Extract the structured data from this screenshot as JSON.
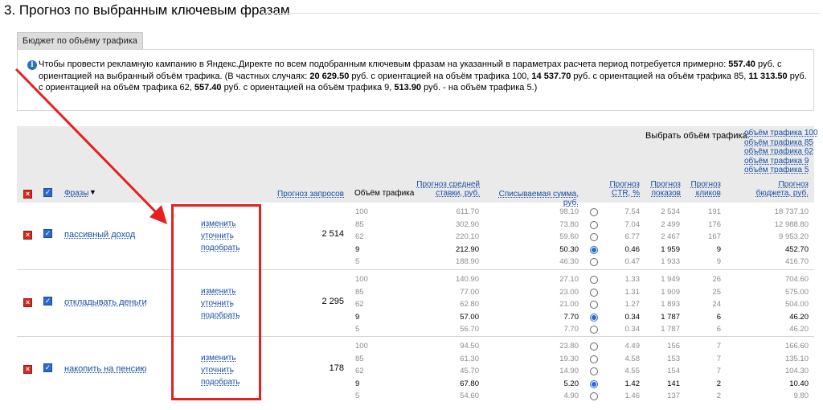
{
  "section": {
    "title": "3. Прогноз по выбранным ключевым фразам"
  },
  "tab": {
    "label": "Бюджет по объёму трафика"
  },
  "info": {
    "t1": "Чтобы провести рекламную кампанию в Яндекс.Директе по всем подобранным ключевым фразам на указанный в параметрах расчета период потребуется примерно: ",
    "b1": "557.40",
    "t2": " руб. с ориентацией на выбранный объём трафика. (В частных случаях: ",
    "b2": "20 629.50",
    "t3": " руб. с ориентацией на объём трафика 100, ",
    "b3": "14 537.70",
    "t4": " руб. с ориентацией на объём трафика 85, ",
    "b4": "11 313.50",
    "t5": " руб. с ориентацией на объём трафика 62, ",
    "b5": "557.40",
    "t6": " руб. с ориентацией на объём трафика 9, ",
    "b6": "513.90",
    "t7": " руб. - на объём трафика 5.)"
  },
  "header": {
    "choose_label": "Выбрать объём трафика:",
    "levels": [
      "объём трафика 100",
      "объём трафика 85",
      "объём трафика 62",
      "объём трафика 9",
      "объём трафика 5"
    ],
    "phrases": "Фразы",
    "phrases_sort": "▼",
    "forecast_requests": "Прогноз запросов",
    "traffic_volume": "Объём трафика",
    "avg_bid_1": "Прогноз средней",
    "avg_bid_2": "ставки, руб.",
    "charged": "Списываемая сумма, руб.",
    "ctr_1": "Прогноз",
    "ctr_2": "CTR, %",
    "impr_1": "Прогноз",
    "impr_2": "показов",
    "clicks_1": "Прогноз",
    "clicks_2": "кликов",
    "budget_1": "Прогноз",
    "budget_2": "бюджета, руб."
  },
  "actions": {
    "change": "изменить",
    "refine": "уточнить",
    "pick": "подобрать"
  },
  "rows": [
    {
      "phrase": "пассивный доход",
      "forecast": "2 514",
      "lines": [
        {
          "vol": "100",
          "bid": "611.70",
          "charge": "98.10",
          "ctr": "7.54",
          "impr": "2 534",
          "clicks": "191",
          "budget": "18 737.10"
        },
        {
          "vol": "85",
          "bid": "302.90",
          "charge": "73.80",
          "ctr": "7.04",
          "impr": "2 499",
          "clicks": "176",
          "budget": "12 988.80"
        },
        {
          "vol": "62",
          "bid": "220.10",
          "charge": "59.60",
          "ctr": "6.77",
          "impr": "2 467",
          "clicks": "167",
          "budget": "9 953.20"
        },
        {
          "vol": "9",
          "bid": "212.90",
          "charge": "50.30",
          "ctr": "0.46",
          "impr": "1 959",
          "clicks": "9",
          "budget": "452.70"
        },
        {
          "vol": "5",
          "bid": "188.90",
          "charge": "46.30",
          "ctr": "0.47",
          "impr": "1 933",
          "clicks": "9",
          "budget": "416.70"
        }
      ]
    },
    {
      "phrase": "откладывать деньги",
      "forecast": "2 295",
      "lines": [
        {
          "vol": "100",
          "bid": "140.90",
          "charge": "27.10",
          "ctr": "1.33",
          "impr": "1 949",
          "clicks": "26",
          "budget": "704.60"
        },
        {
          "vol": "85",
          "bid": "77.00",
          "charge": "23.00",
          "ctr": "1.31",
          "impr": "1 909",
          "clicks": "25",
          "budget": "575.00"
        },
        {
          "vol": "62",
          "bid": "62.80",
          "charge": "21.00",
          "ctr": "1.27",
          "impr": "1 893",
          "clicks": "24",
          "budget": "504.00"
        },
        {
          "vol": "9",
          "bid": "57.00",
          "charge": "7.70",
          "ctr": "0.34",
          "impr": "1 787",
          "clicks": "6",
          "budget": "46.20"
        },
        {
          "vol": "5",
          "bid": "56.70",
          "charge": "7.70",
          "ctr": "0.34",
          "impr": "1 787",
          "clicks": "6",
          "budget": "46.20"
        }
      ]
    },
    {
      "phrase": "накопить на пенсию",
      "forecast": "178",
      "lines": [
        {
          "vol": "100",
          "bid": "94.50",
          "charge": "23.80",
          "ctr": "4.49",
          "impr": "156",
          "clicks": "7",
          "budget": "166.60"
        },
        {
          "vol": "85",
          "bid": "61.30",
          "charge": "19.30",
          "ctr": "4.58",
          "impr": "153",
          "clicks": "7",
          "budget": "135.10"
        },
        {
          "vol": "62",
          "bid": "45.70",
          "charge": "14.90",
          "ctr": "4.55",
          "impr": "154",
          "clicks": "7",
          "budget": "104.30"
        },
        {
          "vol": "9",
          "bid": "67.80",
          "charge": "5.20",
          "ctr": "1.42",
          "impr": "141",
          "clicks": "2",
          "budget": "10.40"
        },
        {
          "vol": "5",
          "bid": "54.60",
          "charge": "4.90",
          "ctr": "1.46",
          "impr": "137",
          "clicks": "2",
          "budget": "9.80"
        }
      ]
    }
  ],
  "selected_level_index": 3,
  "colors": {
    "link": "#1a4ea0",
    "annotation": "#e62020",
    "header_bg": "#eaeaea"
  }
}
